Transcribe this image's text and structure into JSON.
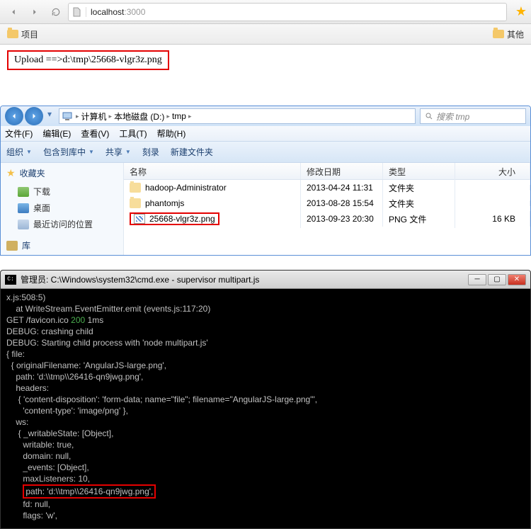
{
  "browser": {
    "address_host": "localhost",
    "address_port": ":3000",
    "bookmark1": "项目",
    "bookmark2": "其他"
  },
  "page": {
    "upload_text": "Upload ==>d:\\tmp\\25668-vlgr3z.png"
  },
  "explorer": {
    "breadcrumb": [
      "计算机",
      "本地磁盘 (D:)",
      "tmp"
    ],
    "search_placeholder": "搜索 tmp",
    "menu": {
      "file": "文件(F)",
      "edit": "编辑(E)",
      "view": "查看(V)",
      "tools": "工具(T)",
      "help": "帮助(H)"
    },
    "cmd": {
      "org": "组织",
      "inc": "包含到库中",
      "share": "共享",
      "burn": "刻录",
      "new": "新建文件夹"
    },
    "side": {
      "fav": "收藏夹",
      "dl": "下载",
      "desk": "桌面",
      "recent": "最近访问的位置",
      "lib": "库"
    },
    "cols": {
      "name": "名称",
      "date": "修改日期",
      "type": "类型",
      "size": "大小"
    },
    "rows": [
      {
        "name": "hadoop-Administrator",
        "date": "2013-04-24 11:31",
        "type": "文件夹",
        "size": "",
        "kind": "folder"
      },
      {
        "name": "phantomjs",
        "date": "2013-08-28 15:54",
        "type": "文件夹",
        "size": "",
        "kind": "folder"
      },
      {
        "name": "25668-vlgr3z.png",
        "date": "2013-09-23 20:30",
        "type": "PNG 文件",
        "size": "16 KB",
        "kind": "png",
        "hl": true
      }
    ]
  },
  "cmd": {
    "title": "管理员: C:\\Windows\\system32\\cmd.exe - supervisor  multipart.js",
    "lines": [
      "x.js:508:5)",
      "    at WriteStream.EventEmitter.emit (events.js:117:20)",
      "GET /favicon.ico |200| 1ms",
      "DEBUG: crashing child",
      "DEBUG: Starting child process with 'node multipart.js'",
      "{ file:",
      "  { originalFilename: 'AngularJS-large.png',",
      "    path: 'd:\\\\tmp\\\\26416-qn9jwg.png',",
      "    headers:",
      "     { 'content-disposition': 'form-data; name=\"file\"; filename=\"AngularJS-large.png\"',",
      "       'content-type': 'image/png' },",
      "    ws:",
      "     { _writableState: [Object],",
      "       writable: true,",
      "       domain: null,",
      "       _events: [Object],",
      "       maxListeners: 10,",
      "       |HL|path: 'd:\\\\tmp\\\\26416-qn9jwg.png',|/HL|",
      "       fd: null,",
      "       flags: 'w',"
    ]
  }
}
